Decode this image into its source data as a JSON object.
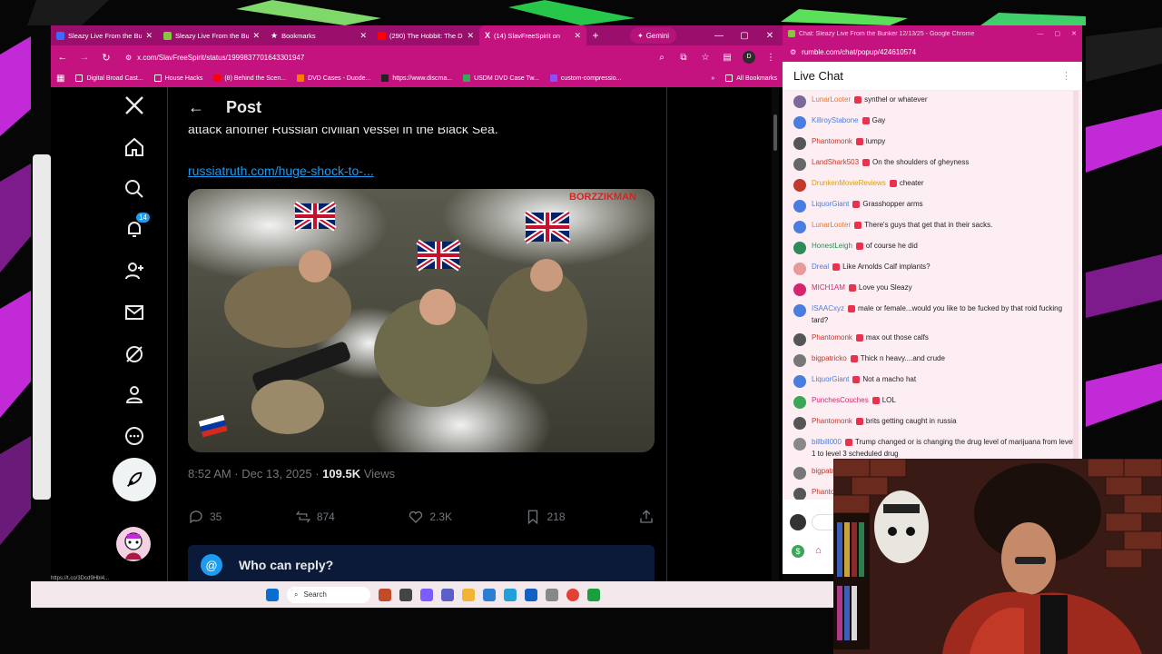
{
  "browser": {
    "tabs": [
      {
        "label": "Sleazy Live From the Bu",
        "icon": "rumble-icon",
        "color": "#3b6cff"
      },
      {
        "label": "Sleazy Live From the Bu",
        "icon": "rumble-icon",
        "color": "#85c742"
      },
      {
        "label": "Bookmarks",
        "icon": "star-icon",
        "color": "#ffffff"
      },
      {
        "label": "(290) The Hobbit: The D",
        "icon": "youtube-icon",
        "color": "#ff0000"
      },
      {
        "label": "(14) SlavFreeSpirit on",
        "icon": "x-icon",
        "color": "#000000",
        "active": true
      }
    ],
    "gemini_label": "Gemini",
    "url": "x.com/SlavFreeSpirit/status/1999837701643301947",
    "bookmarks": [
      "Digital Broad Cast...",
      "House Hacks",
      "(8) Behind the Scen...",
      "DVD Cases - Duode...",
      "https://www.discma...",
      "USDM DVD Case Tw...",
      "custom-compressio..."
    ],
    "all_bookmarks": "All Bookmarks",
    "profile_initial": "D"
  },
  "x": {
    "header_title": "Post",
    "cut_text": "attack another Russian civilian vessel in the Black Sea.",
    "link": "russiatruth.com/huge-shock-to-...",
    "notifications_badge": "14",
    "watermark": "BORZZIKMAN",
    "time": "8:52 AM · Dec 13, 2025",
    "views_count": "109.5K",
    "views_label": "Views",
    "replies": "35",
    "reposts": "874",
    "likes": "2.3K",
    "bookmarks": "218",
    "reply_box_title": "Who can reply?"
  },
  "taskbar": {
    "search_placeholder": "Search"
  },
  "statusbar": {
    "url": "https://t.co/3Dcd9Hbl4..."
  },
  "chat": {
    "window_title": "Chat: Sleazy Live From the Bunker 12/13/25 - Google Chrome",
    "url": "rumble.com/chat/popup/424610574",
    "header": "Live Chat",
    "messages": [
      {
        "user": "LunarLooter",
        "text": "synthel or whatever",
        "color": "#e07b39",
        "av": "#7a6a9a"
      },
      {
        "user": "KillroyStabone",
        "text": "Gay",
        "color": "#4a7de0",
        "av": "#4a7de0"
      },
      {
        "user": "Phantomonk",
        "text": "lumpy",
        "color": "#c0392b",
        "av": "#555555"
      },
      {
        "user": "LandShark503",
        "text": "On the shoulders of gheyness",
        "color": "#c0392b",
        "av": "#666666"
      },
      {
        "user": "DrunkenMovieReviews",
        "text": "cheater",
        "color": "#d4a017",
        "av": "#c0392b"
      },
      {
        "user": "LiquorGiant",
        "text": "Grasshopper arms",
        "color": "#4a7de0",
        "av": "#4a7de0"
      },
      {
        "user": "LunarLooter",
        "text": "There's guys that get that in their sacks.",
        "color": "#e07b39",
        "av": "#4a7de0"
      },
      {
        "user": "HonestLeigh",
        "text": "of course he did",
        "color": "#2e8b57",
        "av": "#2e8b57"
      },
      {
        "user": "Dreal",
        "text": "Like Arnolds Calf implants?",
        "color": "#4a7de0",
        "av": "#e89a9a"
      },
      {
        "user": "MICH1AM",
        "text": "Love you Sleazy",
        "color": "#d6246e",
        "av": "#d6246e"
      },
      {
        "user": "ISAACxyz",
        "text": "male or female...would you like to be fucked by that roid fucking tard?",
        "color": "#4a7de0",
        "av": "#4a7de0"
      },
      {
        "user": "Phantomonk",
        "text": "max out those calfs",
        "color": "#c0392b",
        "av": "#555555"
      },
      {
        "user": "bigpatricko",
        "text": "Thick n heavy....and crude",
        "color": "#c0392b",
        "av": "#777777"
      },
      {
        "user": "LiquorGiant",
        "text": "Not a macho hat",
        "color": "#4a7de0",
        "av": "#4a7de0"
      },
      {
        "user": "PunchesCouches",
        "text": "LOL",
        "color": "#d6246e",
        "av": "#3aa757"
      },
      {
        "user": "Phantomonk",
        "text": "brits getting caught in russia",
        "color": "#c0392b",
        "av": "#555555"
      },
      {
        "user": "billbill000",
        "text": "Trump changed or is changing the drug level of marijuana from level 1 to level 3 scheduled drug",
        "color": "#4a7de0",
        "av": "#888888"
      },
      {
        "user": "bigpatricko",
        "text": "",
        "color": "#c0392b",
        "av": "#777777"
      },
      {
        "user": "Phantomonk",
        "text": "",
        "color": "#c0392b",
        "av": "#555555"
      }
    ]
  }
}
